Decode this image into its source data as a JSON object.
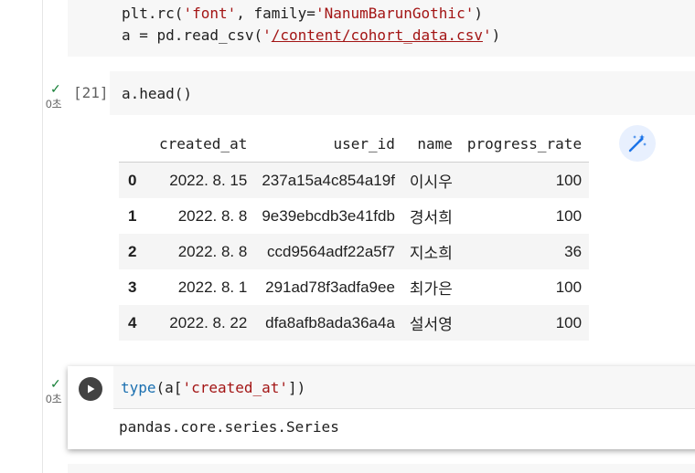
{
  "cell1": {
    "line1": {
      "a": "plt.rc(",
      "b": "'font'",
      "c": ", family=",
      "d": "'NanumBarunGothic'",
      "e": ")"
    },
    "line2": {
      "a": "a = pd.read_csv(",
      "q1": "'",
      "path": "/content/cohort_data.csv",
      "q2": "'",
      "e": ")"
    }
  },
  "cell2": {
    "status": "✓",
    "time": "0초",
    "exec_count": "[21]",
    "code": "a.head()",
    "table": {
      "columns": [
        "",
        "created_at",
        "user_id",
        "name",
        "progress_rate"
      ],
      "rows": [
        {
          "index": "0",
          "created_at": "2022. 8. 15",
          "user_id": "237a15a4c854a19f",
          "name": "이시우",
          "progress_rate": "100"
        },
        {
          "index": "1",
          "created_at": "2022. 8. 8",
          "user_id": "9e39ebcdb3e41fdb",
          "name": "경서희",
          "progress_rate": "100"
        },
        {
          "index": "2",
          "created_at": "2022. 8. 8",
          "user_id": "ccd9564adf22a5f7",
          "name": "지소희",
          "progress_rate": "36"
        },
        {
          "index": "3",
          "created_at": "2022. 8. 1",
          "user_id": "291ad78f3adfa9ee",
          "name": "최가은",
          "progress_rate": "100"
        },
        {
          "index": "4",
          "created_at": "2022. 8. 22",
          "user_id": "dfa8afb8ada36a4a",
          "name": "설서영",
          "progress_rate": "100"
        }
      ]
    }
  },
  "cell3": {
    "status": "✓",
    "time": "0초",
    "code": {
      "fn": "type",
      "p1": "(",
      "a": "a[",
      "str": "'created_at'",
      "p2": "])"
    },
    "output": "pandas.core.series.Series"
  },
  "colors": {
    "string": "#a31515",
    "check": "#188038",
    "accent": "#1a6fb0"
  },
  "icons": {
    "run": "play-icon",
    "magic": "magic-wand-icon",
    "check": "check-icon"
  }
}
